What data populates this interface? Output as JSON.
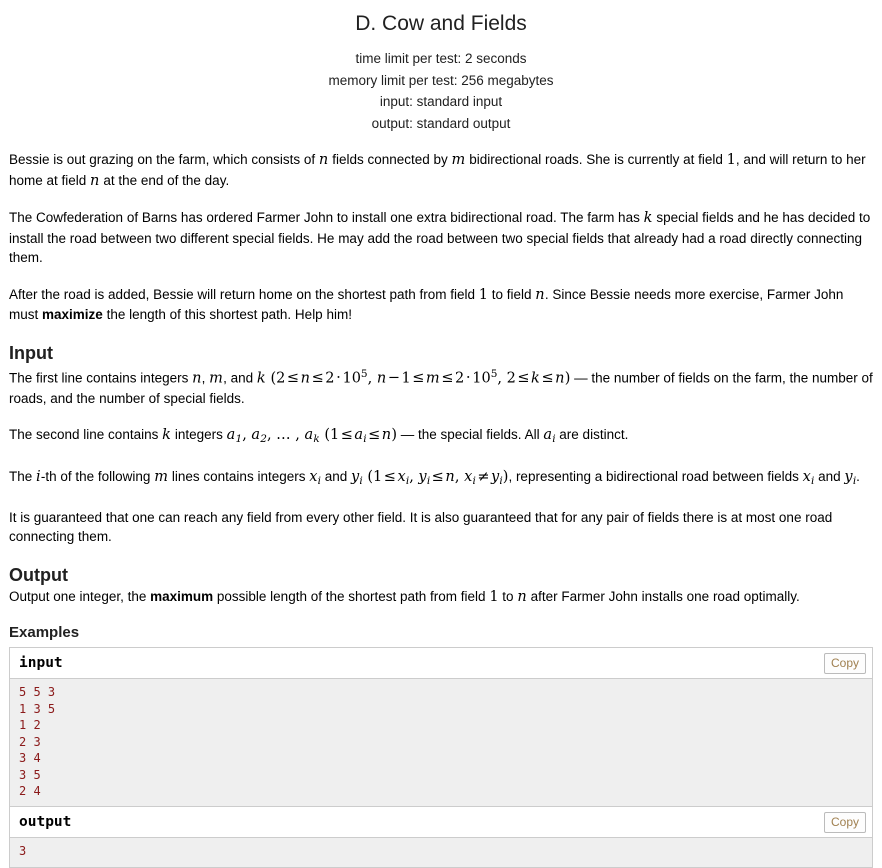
{
  "header": {
    "title": "D. Cow and Fields",
    "time_limit": "time limit per test: 2 seconds",
    "memory_limit": "memory limit per test: 256 megabytes",
    "input_spec": "input: standard input",
    "output_spec": "output: standard output"
  },
  "legend": {
    "p1_a": "Bessie is out grazing on the farm, which consists of ",
    "p1_n": "n",
    "p1_b": " fields connected by ",
    "p1_m": "m",
    "p1_c": " bidirectional roads. She is currently at field ",
    "p1_one": "1",
    "p1_d": ", and will return to her home at field ",
    "p1_n2": "n",
    "p1_e": " at the end of the day.",
    "p2_a": "The Cowfederation of Barns has ordered Farmer John to install one extra bidirectional road. The farm has ",
    "p2_k": "k",
    "p2_b": " special fields and he has decided to install the road between two different special fields. He may add the road between two special fields that already had a road directly connecting them.",
    "p3_a": "After the road is added, Bessie will return home on the shortest path from field ",
    "p3_one": "1",
    "p3_b": " to field ",
    "p3_n": "n",
    "p3_c": ". Since Bessie needs more exercise, Farmer John must ",
    "p3_bold": "maximize",
    "p3_d": " the length of this shortest path. Help him!"
  },
  "input_section": {
    "heading": "Input",
    "l1_a": "The first line contains integers ",
    "l1_n": "n",
    "l1_comma1": ", ",
    "l1_m": "m",
    "l1_and": ", and ",
    "l1_k": "k",
    "l1_paren_open": " (",
    "l1_c1_two": "2",
    "l1_le1": "≤",
    "l1_c1_n": "n",
    "l1_le2": "≤",
    "l1_c1_2": "2",
    "l1_cdot": "⋅",
    "l1_c1_10": "10",
    "l1_c1_exp": "5",
    "l1_sep1": ", ",
    "l1_c2_n": "n",
    "l1_minus": "−",
    "l1_c2_1": "1",
    "l1_le3": "≤",
    "l1_c2_m": "m",
    "l1_le4": "≤",
    "l1_c2_2": "2",
    "l1_cdot2": "⋅",
    "l1_c2_10": "10",
    "l1_c2_exp": "5",
    "l1_sep2": ", ",
    "l1_c3_2": "2",
    "l1_le5": "≤",
    "l1_c3_k": "k",
    "l1_le6": "≤",
    "l1_c3_n": "n",
    "l1_paren_close": ")",
    "l1_tail": " — the number of fields on the farm, the number of roads, and the number of special fields.",
    "l2_a": "The second line contains ",
    "l2_k": "k",
    "l2_b": " integers ",
    "l2_a1": "a",
    "l2_a1s": "1",
    "l2_c1": ", ",
    "l2_a2": "a",
    "l2_a2s": "2",
    "l2_c2": ", … , ",
    "l2_ak": "a",
    "l2_aks": "k",
    "l2_paren_open": " (",
    "l2_one": "1",
    "l2_le1": "≤",
    "l2_ai": "a",
    "l2_ais": "i",
    "l2_le2": "≤",
    "l2_n": "n",
    "l2_paren_close": ")",
    "l2_tail1": " — the special fields. All ",
    "l2_ai2": "a",
    "l2_ai2s": "i",
    "l2_tail2": " are distinct.",
    "l3_a": "The ",
    "l3_i": "i",
    "l3_b": "-th of the following ",
    "l3_m": "m",
    "l3_c": " lines contains integers ",
    "l3_x": "x",
    "l3_xs": "i",
    "l3_and": " and ",
    "l3_y": "y",
    "l3_ys": "i",
    "l3_paren_open": " (",
    "l3_one": "1",
    "l3_le1": "≤",
    "l3_x2": "x",
    "l3_x2s": "i",
    "l3_comma": ", ",
    "l3_y2": "y",
    "l3_y2s": "i",
    "l3_le2": "≤",
    "l3_n": "n",
    "l3_comma2": ", ",
    "l3_x3": "x",
    "l3_x3s": "i",
    "l3_neq": "≠",
    "l3_y3": "y",
    "l3_y3s": "i",
    "l3_paren_close": ")",
    "l3_tail": ", representing a bidirectional road between fields ",
    "l3_x4": "x",
    "l3_x4s": "i",
    "l3_and2": " and ",
    "l3_y4": "y",
    "l3_y4s": "i",
    "l3_period": ".",
    "l4": "It is guaranteed that one can reach any field from every other field. It is also guaranteed that for any pair of fields there is at most one road connecting them."
  },
  "output_section": {
    "heading": "Output",
    "o1_a": "Output one integer, the ",
    "o1_bold": "maximum",
    "o1_b": " possible length of the shortest path from field ",
    "o1_one": "1",
    "o1_c": " to ",
    "o1_n": "n",
    "o1_d": " after Farmer John installs one road optimally."
  },
  "examples": {
    "heading": "Examples",
    "input_label": "input",
    "output_label": "output",
    "copy_label": "Copy",
    "input_data": "5 5 3\n1 3 5\n1 2\n2 3\n3 4\n3 5\n2 4",
    "output_data": "3"
  },
  "colors": {
    "sample_text": "#8b1a1a",
    "sample_bg": "#efefef",
    "border": "#cccccc",
    "copy_text": "#a08050"
  }
}
